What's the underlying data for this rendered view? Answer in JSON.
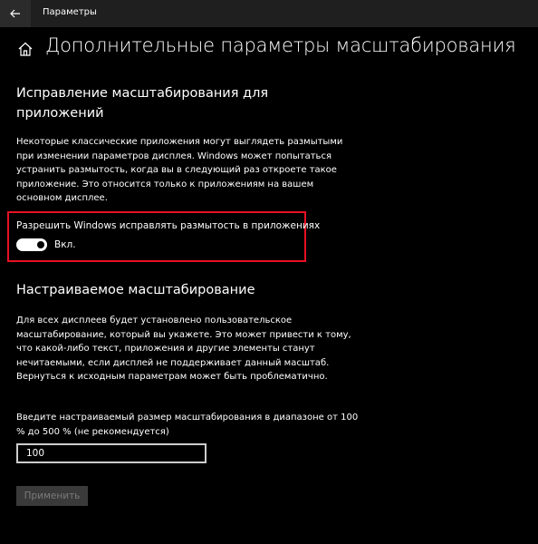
{
  "window": {
    "title": "Параметры"
  },
  "page": {
    "title": "Дополнительные параметры масштабирования"
  },
  "fix_scaling": {
    "heading_line1": "Исправление масштабирования для",
    "heading_line2": "приложений",
    "description": "Некоторые классические приложения могут выглядеть размытыми при изменении параметров дисплея. Windows может попытаться устранить размытость, когда вы в следующий раз откроете такое приложение. Это относится только к приложениям на вашем основном дисплее.",
    "toggle_label": "Разрешить Windows исправлять размытость в приложениях",
    "toggle_state": "Вкл.",
    "toggle_on": true
  },
  "custom_scaling": {
    "heading": "Настраиваемое масштабирование",
    "description": "Для всех дисплеев будет установлено пользовательское масштабирование, который вы укажете. Это может привести к тому, что какой-либо текст, приложения и другие элементы станут нечитаемыми, если дисплей не поддерживает данный масштаб. Вернуться к исходным параметрам может быть проблематично.",
    "input_hint": "Введите настраиваемый размер масштабирования в диапазоне от 100 % до 500 % (не рекомендуется)",
    "input_value": "100",
    "apply_label": "Применить"
  },
  "colors": {
    "accent_highlight": "#e81123",
    "background": "#000000"
  },
  "icons": {
    "back": "back-arrow-icon",
    "home": "home-icon"
  }
}
